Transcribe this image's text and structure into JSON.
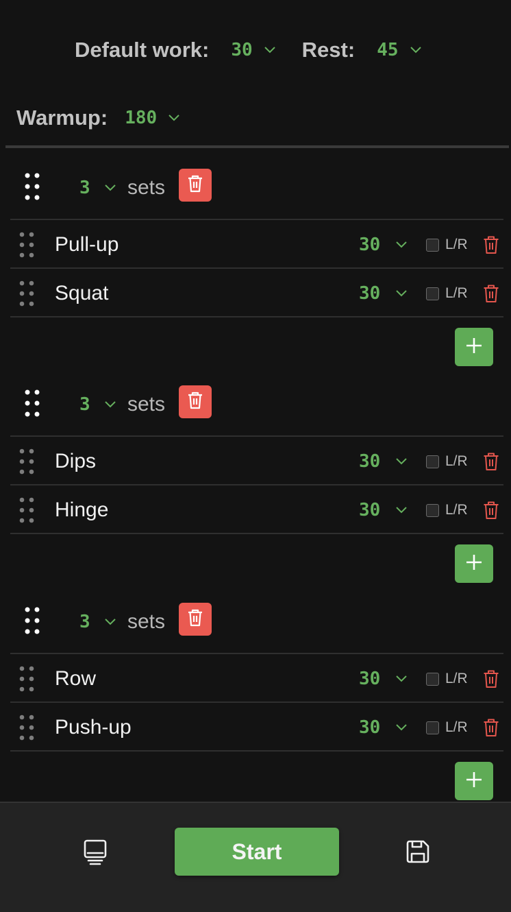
{
  "header": {
    "default_work_label": "Default work:",
    "default_work_value": "30",
    "rest_label": "Rest:",
    "rest_value": "45",
    "warmup_label": "Warmup:",
    "warmup_value": "180"
  },
  "groups": [
    {
      "sets_value": "3",
      "sets_label": "sets",
      "exercises": [
        {
          "name": "Pull-up",
          "duration": "30",
          "lr_label": "L/R"
        },
        {
          "name": "Squat",
          "duration": "30",
          "lr_label": "L/R"
        }
      ]
    },
    {
      "sets_value": "3",
      "sets_label": "sets",
      "exercises": [
        {
          "name": "Dips",
          "duration": "30",
          "lr_label": "L/R"
        },
        {
          "name": "Hinge",
          "duration": "30",
          "lr_label": "L/R"
        }
      ]
    },
    {
      "sets_value": "3",
      "sets_label": "sets",
      "exercises": [
        {
          "name": "Row",
          "duration": "30",
          "lr_label": "L/R"
        },
        {
          "name": "Push-up",
          "duration": "30",
          "lr_label": "L/R"
        }
      ]
    }
  ],
  "bottom_bar": {
    "start_label": "Start",
    "left_icon": "monitor-icon",
    "right_icon": "save-icon"
  },
  "colors": {
    "accent_green": "#5fab56",
    "value_green": "#66b05e",
    "danger_red": "#ea5a51",
    "background": "#131313"
  }
}
